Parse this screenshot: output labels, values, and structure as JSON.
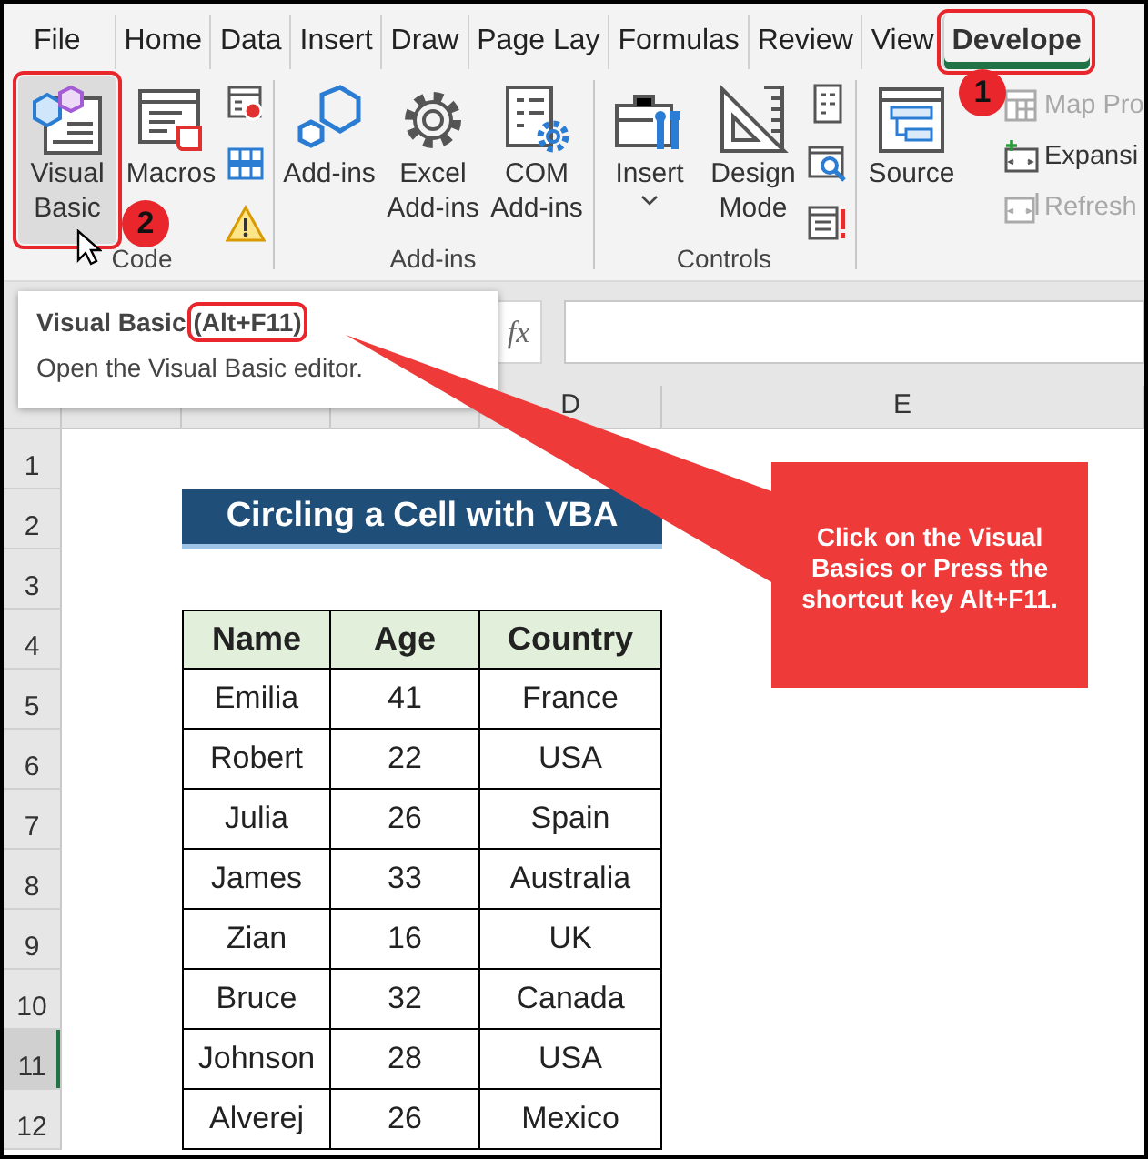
{
  "tabs": [
    {
      "label": "File",
      "selected": false,
      "highlighted": false
    },
    {
      "label": "Home",
      "selected": false,
      "highlighted": false
    },
    {
      "label": "Data",
      "selected": false,
      "highlighted": false
    },
    {
      "label": "Insert",
      "selected": false,
      "highlighted": false
    },
    {
      "label": "Draw",
      "selected": false,
      "highlighted": false
    },
    {
      "label": "Page Lay",
      "selected": false,
      "highlighted": false
    },
    {
      "label": "Formulas",
      "selected": false,
      "highlighted": false
    },
    {
      "label": "Review",
      "selected": false,
      "highlighted": false
    },
    {
      "label": "View",
      "selected": false,
      "highlighted": false
    },
    {
      "label": "Develope",
      "selected": true,
      "highlighted": true
    }
  ],
  "ribbon": {
    "groups": [
      {
        "label": "Code",
        "items": [
          {
            "kind": "large",
            "label": "Visual Basic",
            "hovered": true,
            "highlighted": true
          },
          {
            "kind": "large",
            "label": "Macros",
            "hovered": false,
            "highlighted": false
          },
          {
            "kind": "icon"
          },
          {
            "kind": "icon"
          },
          {
            "kind": "icon"
          }
        ]
      },
      {
        "label": "Add-ins",
        "items": [
          {
            "kind": "large",
            "label": "Add-ins",
            "hovered": false,
            "highlighted": false
          },
          {
            "kind": "large",
            "label": "Excel Add-ins",
            "hovered": false,
            "highlighted": false
          },
          {
            "kind": "large",
            "label": "COM Add-ins",
            "hovered": false,
            "highlighted": false
          }
        ]
      },
      {
        "label": "Controls",
        "items": [
          {
            "kind": "large",
            "label": "Insert",
            "hovered": false,
            "highlighted": false,
            "dropdown": true
          },
          {
            "kind": "large",
            "label": "Design Mode",
            "hovered": false,
            "highlighted": false
          },
          {
            "kind": "icon"
          },
          {
            "kind": "icon"
          },
          {
            "kind": "icon"
          }
        ]
      },
      {
        "items": [
          {
            "kind": "large",
            "label": "Source",
            "hovered": false,
            "highlighted": false
          },
          {
            "kind": "small",
            "label": "Map Pro",
            "disabled": true
          },
          {
            "kind": "small",
            "label": "Expansi",
            "disabled": false
          },
          {
            "kind": "small",
            "label": "Refresh",
            "disabled": true
          }
        ]
      }
    ]
  },
  "tooltip": {
    "title": "Visual Basic",
    "shortcut": "(Alt+F11)",
    "shortcut_highlighted": true,
    "description": "Open the Visual Basic editor."
  },
  "formula_bar": {
    "function_label": "fx"
  },
  "sheet": {
    "column_headers": [
      {
        "label": "D"
      },
      {
        "label": "E"
      }
    ],
    "row_headers": [
      {
        "label": "1",
        "selected": false
      },
      {
        "label": "2",
        "selected": false
      },
      {
        "label": "3",
        "selected": false
      },
      {
        "label": "4",
        "selected": false
      },
      {
        "label": "5",
        "selected": false
      },
      {
        "label": "6",
        "selected": false
      },
      {
        "label": "7",
        "selected": false
      },
      {
        "label": "8",
        "selected": false
      },
      {
        "label": "9",
        "selected": false
      },
      {
        "label": "10",
        "selected": false
      },
      {
        "label": "11",
        "selected": true
      },
      {
        "label": "12",
        "selected": false
      }
    ],
    "title": "Circling a Cell with VBA",
    "table": {
      "columns": [
        "Name",
        "Age",
        "Country"
      ],
      "rows": [
        [
          "Emilia",
          "41",
          "France"
        ],
        [
          "Robert",
          "22",
          "USA"
        ],
        [
          "Julia",
          "26",
          "Spain"
        ],
        [
          "James",
          "33",
          "Australia"
        ],
        [
          "Zian",
          "16",
          "UK"
        ],
        [
          "Bruce",
          "32",
          "Canada"
        ],
        [
          "Johnson",
          "28",
          "USA"
        ],
        [
          "Alverej",
          "26",
          "Mexico"
        ]
      ]
    }
  },
  "annotations": {
    "steps": [
      {
        "label": "1"
      },
      {
        "label": "2"
      }
    ],
    "callout": "Click on the Visual Basics or Press the shortcut key Alt+F11."
  }
}
